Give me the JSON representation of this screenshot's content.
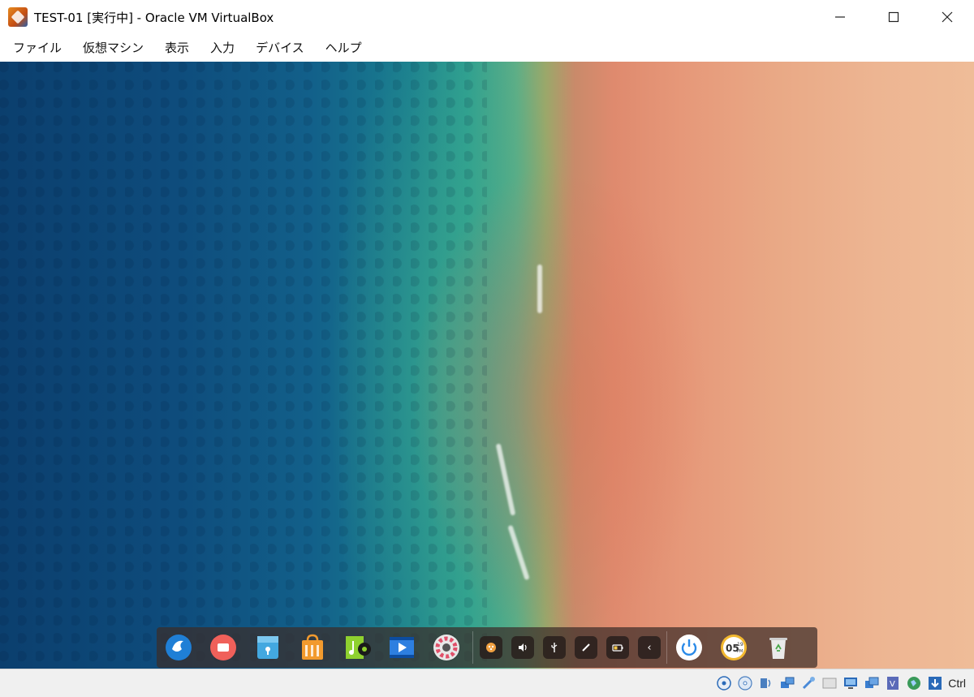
{
  "window": {
    "title": "TEST-01 [実行中] - Oracle VM VirtualBox",
    "icon": "virtualbox-icon"
  },
  "menu": {
    "items": [
      "ファイル",
      "仮想マシン",
      "表示",
      "入力",
      "デバイス",
      "ヘルプ"
    ]
  },
  "dock": {
    "apps": [
      {
        "name": "deepin-launcher-icon"
      },
      {
        "name": "screen-recorder-icon"
      },
      {
        "name": "file-manager-icon"
      },
      {
        "name": "app-store-icon"
      },
      {
        "name": "music-player-icon"
      },
      {
        "name": "movie-player-icon"
      },
      {
        "name": "control-center-icon"
      }
    ],
    "tray": [
      {
        "name": "onboard-keyboard-icon"
      },
      {
        "name": "volume-icon"
      },
      {
        "name": "usb-icon"
      },
      {
        "name": "pen-icon"
      },
      {
        "name": "battery-icon"
      },
      {
        "name": "tray-collapse-icon",
        "glyph": "‹"
      }
    ],
    "clock": {
      "hours": "05",
      "minutes": "19",
      "period": "PM"
    }
  },
  "statusbar": {
    "icons": [
      "hard-disk-icon",
      "optical-drive-icon",
      "audio-icon",
      "network-icon",
      "usb-icon",
      "shared-folder-icon",
      "display-icon",
      "capture-icon",
      "virtualization-icon",
      "mouse-integration-icon",
      "keyboard-icon"
    ],
    "host_key": "Ctrl"
  }
}
